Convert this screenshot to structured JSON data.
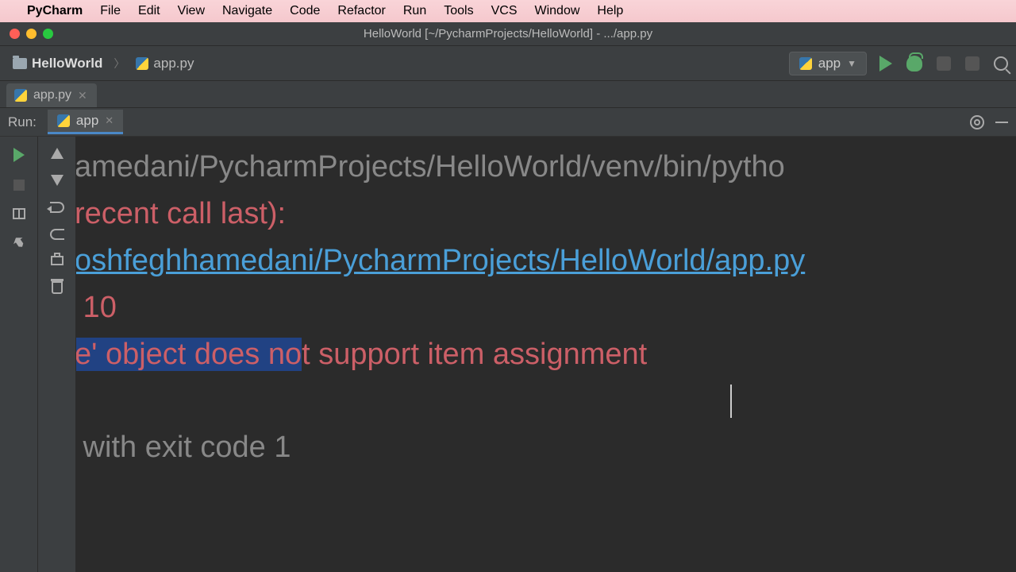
{
  "menu": {
    "apple": "",
    "app": "PyCharm",
    "items": [
      "File",
      "Edit",
      "View",
      "Navigate",
      "Code",
      "Refactor",
      "Run",
      "Tools",
      "VCS",
      "Window",
      "Help"
    ]
  },
  "window": {
    "title": "HelloWorld [~/PycharmProjects/HelloWorld] - .../app.py"
  },
  "breadcrumb": {
    "project": "HelloWorld",
    "file": "app.py"
  },
  "runconfig": {
    "name": "app"
  },
  "editor_tabs": [
    {
      "name": "app.py"
    }
  ],
  "run": {
    "label": "Run:",
    "tab": "app"
  },
  "console": {
    "line1": "amedani/PycharmProjects/HelloWorld/venv/bin/pytho",
    "line2": "recent call last):",
    "line3": "oshfeghhamedani/PycharmProjects/HelloWorld/app.py",
    "line4": " 10",
    "line5_sel": "e' object does no",
    "line5_rest": "t support item assignment",
    "line6": " with exit code 1"
  }
}
